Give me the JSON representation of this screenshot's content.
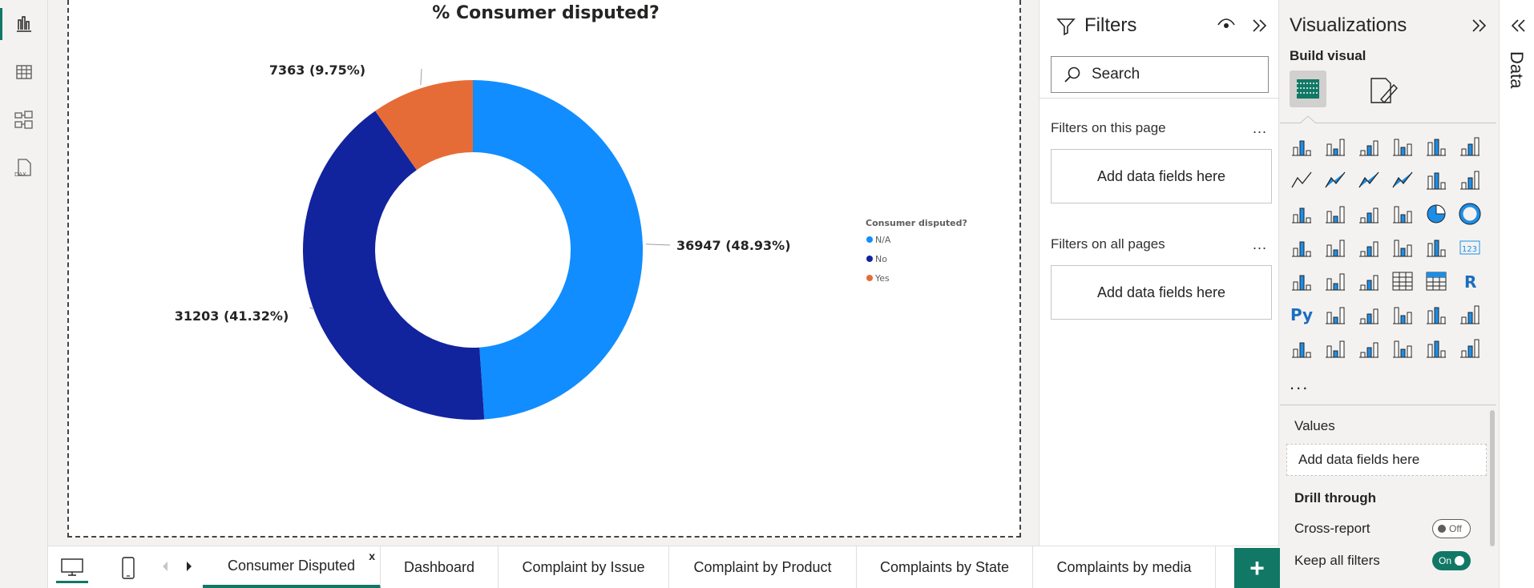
{
  "chart": {
    "title": "% Consumer disputed?",
    "legend_title": "Consumer disputed?",
    "labels": [
      "7363 (9.75%)",
      "36947 (48.93%)",
      "31203 (41.32%)"
    ]
  },
  "chart_data": {
    "type": "pie",
    "title": "% Consumer disputed?",
    "categories": [
      "N/A",
      "No",
      "Yes"
    ],
    "values": [
      36947,
      31203,
      7363
    ],
    "percentages": [
      48.93,
      41.32,
      9.75
    ],
    "colors": [
      "#118dff",
      "#12239e",
      "#e66c37"
    ],
    "legend_title": "Consumer disputed?",
    "legend_position": "right"
  },
  "tabs": [
    {
      "label": "Consumer Disputed",
      "active": true
    },
    {
      "label": "Dashboard"
    },
    {
      "label": "Complaint by Issue"
    },
    {
      "label": "Complaint by Product"
    },
    {
      "label": "Complaints by State"
    },
    {
      "label": "Complaints by media"
    }
  ],
  "tab_close": "x",
  "add_tab": "+",
  "filters": {
    "title": "Filters",
    "search_placeholder": "Search",
    "on_this_page": "Filters on this page",
    "on_all_pages": "Filters on all pages",
    "drop_here": "Add data fields here",
    "more": "..."
  },
  "viz": {
    "title": "Visualizations",
    "build_visual": "Build visual",
    "more": "...",
    "values_label": "Values",
    "values_well": "Add data fields here",
    "drill_through": "Drill through",
    "cross_report": "Cross-report",
    "cross_report_state": "Off",
    "keep_all_filters": "Keep all filters",
    "keep_all_filters_state": "On"
  },
  "data_pane": {
    "label": "Data"
  },
  "colors": {
    "accent": "#117865",
    "na": "#118dff",
    "no": "#12239e",
    "yes": "#e66c37"
  }
}
